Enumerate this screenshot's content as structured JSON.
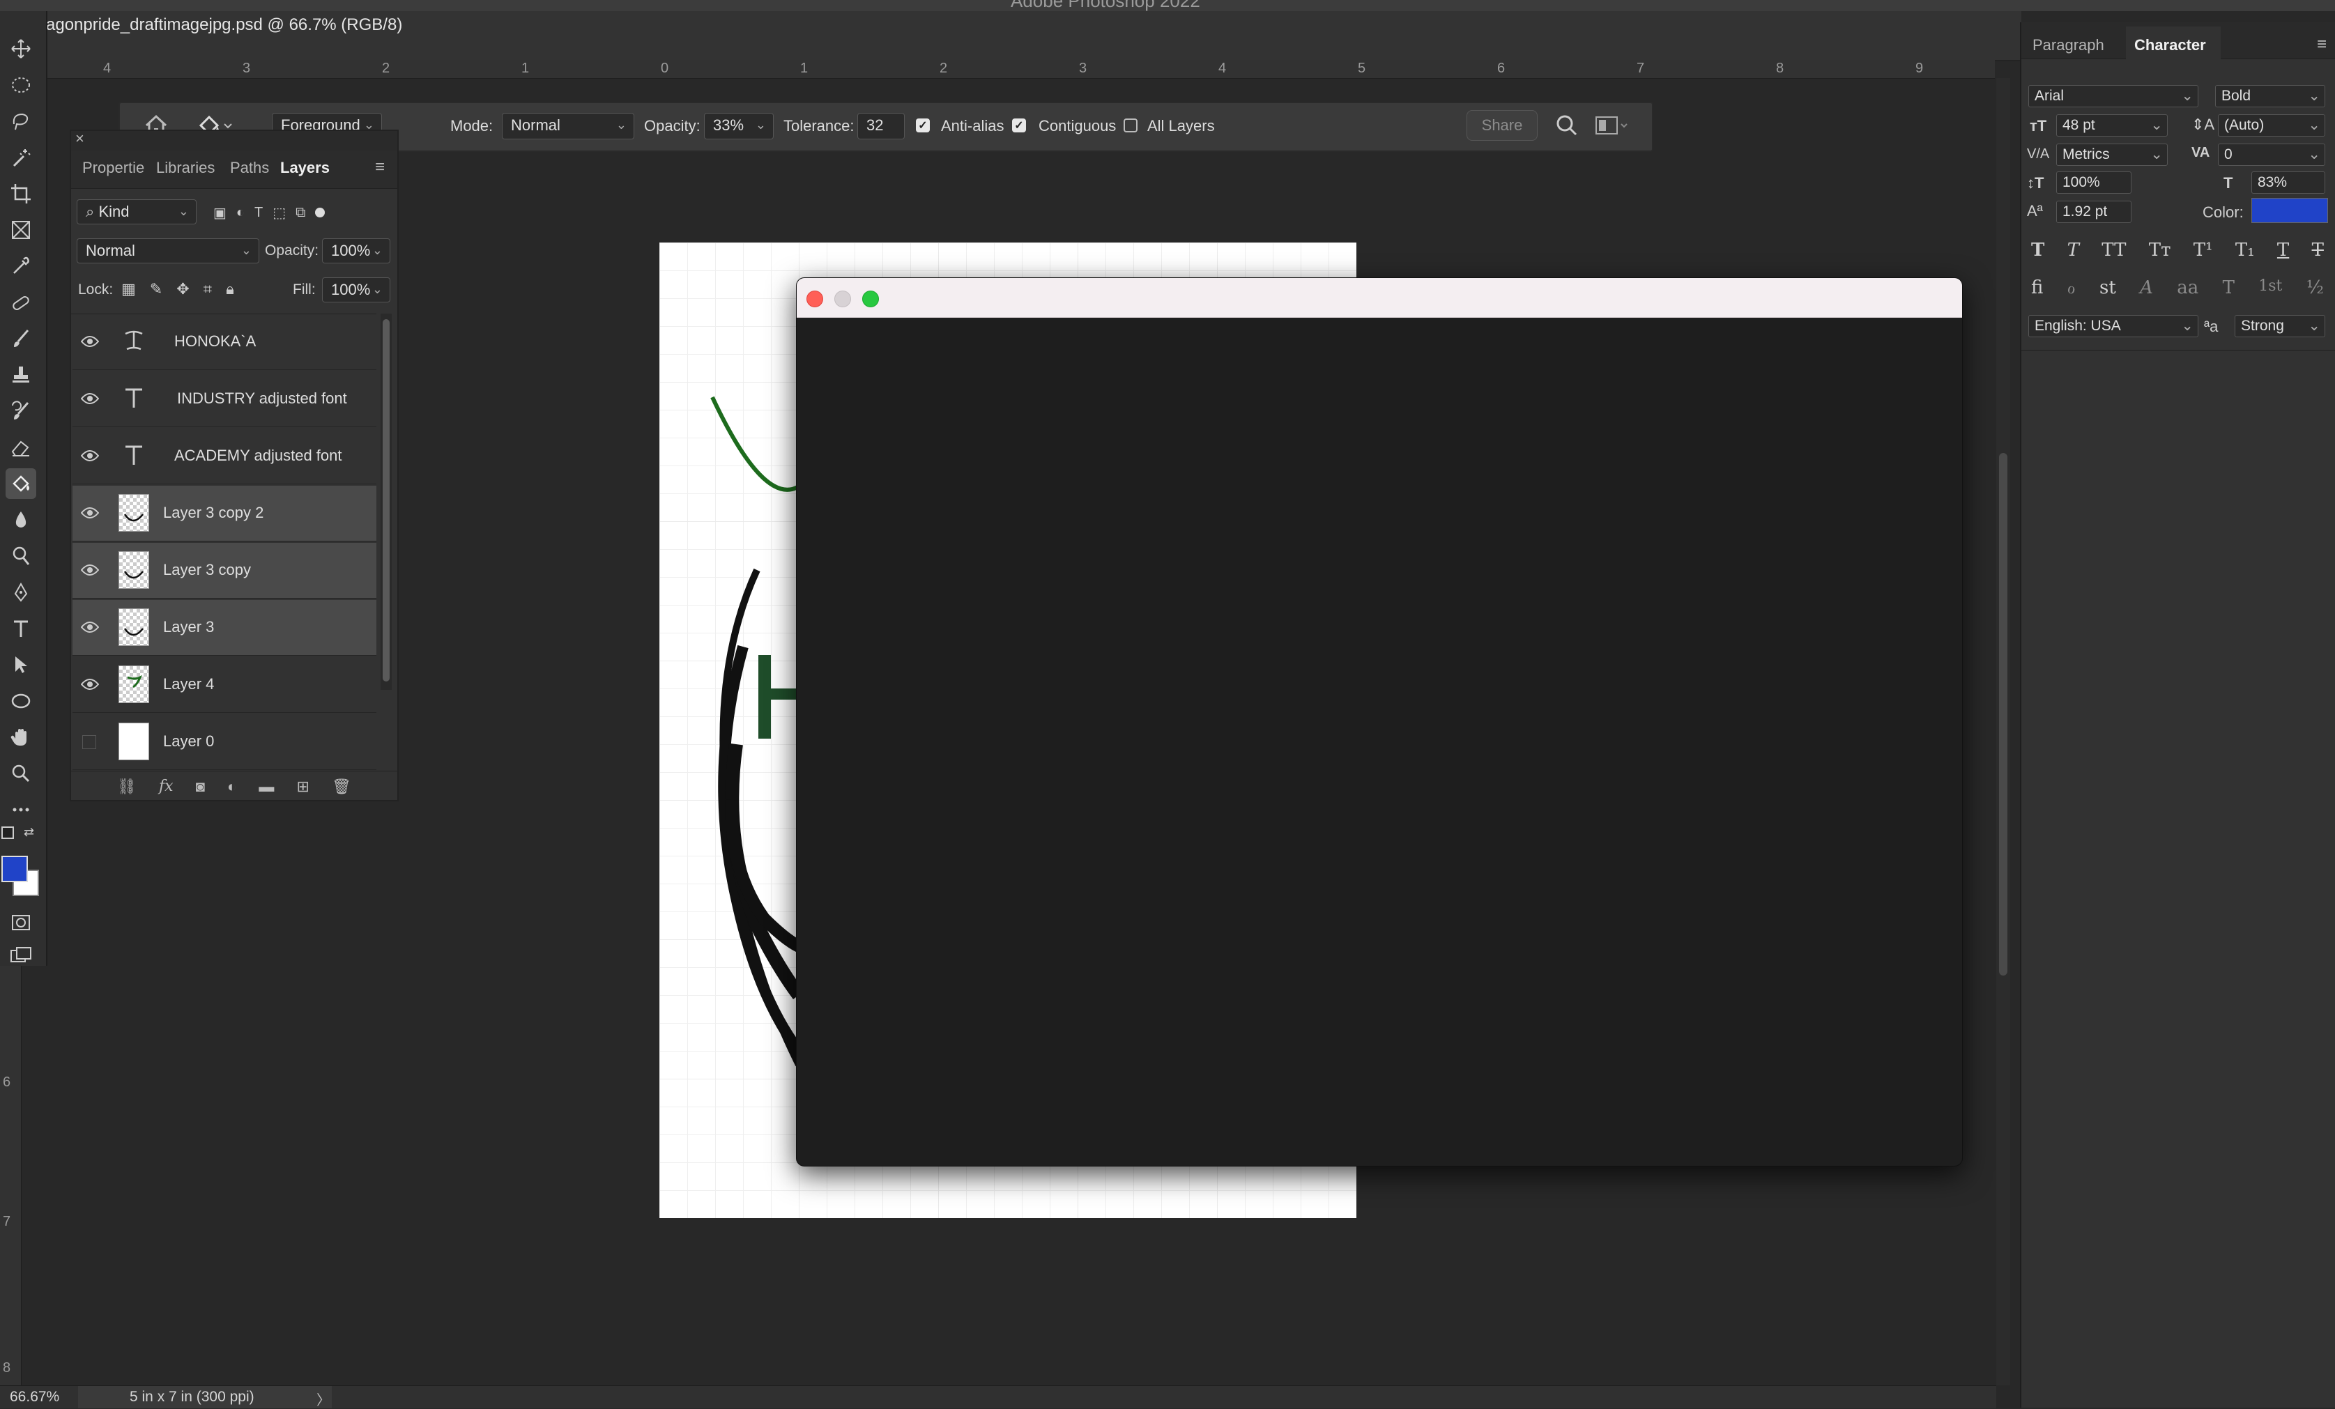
{
  "app": {
    "window_title": "Adobe Photoshop 2022",
    "document_tab": "agonpride_draftimagejpg.psd @ 66.7% (RGB/8)"
  },
  "rulers": {
    "top_marks": [
      "4",
      "3",
      "2",
      "1",
      "0",
      "1",
      "2",
      "3",
      "4",
      "5",
      "6",
      "7",
      "8",
      "9"
    ],
    "left_marks": [
      "6",
      "7",
      "8"
    ]
  },
  "tools": [
    "move-tool",
    "marquee-tool",
    "lasso-tool",
    "magic-wand-tool",
    "crop-tool",
    "frame-tool",
    "eyedropper-tool",
    "healing-brush-tool",
    "brush-tool",
    "clone-stamp-tool",
    "history-brush-tool",
    "eraser-tool",
    "paint-bucket-tool",
    "blur-tool",
    "dodge-tool",
    "pen-tool",
    "type-tool",
    "path-selection-tool",
    "ellipse-tool",
    "hand-tool",
    "zoom-tool",
    "more-tools"
  ],
  "colors": {
    "foreground": "#2043c8",
    "background": "#ffffff",
    "text_color_swatch": "#2043c8"
  },
  "options_bar": {
    "fill_source": "Foreground",
    "mode_label": "Mode:",
    "mode_value": "Normal",
    "opacity_label": "Opacity:",
    "opacity_value": "33%",
    "tolerance_label": "Tolerance:",
    "tolerance_value": "32",
    "anti_alias_label": "Anti-alias",
    "anti_alias_checked": true,
    "contiguous_label": "Contiguous",
    "contiguous_checked": true,
    "all_layers_label": "All Layers",
    "all_layers_checked": false,
    "share_label": "Share"
  },
  "layers_panel": {
    "tabs": [
      "Propertie",
      "Libraries",
      "Paths",
      "Layers"
    ],
    "active_tab": "Layers",
    "filter_kind": "Kind",
    "blend_mode": "Normal",
    "opacity_label": "Opacity:",
    "opacity_value": "100%",
    "lock_label": "Lock:",
    "fill_label": "Fill:",
    "fill_value": "100%",
    "layers": [
      {
        "name": "HONOKA`A",
        "type": "text-warped",
        "visible": true,
        "selected": false
      },
      {
        "name": "INDUSTRY adjusted font",
        "type": "text",
        "visible": true,
        "selected": false
      },
      {
        "name": "ACADEMY adjusted font",
        "type": "text",
        "visible": true,
        "selected": false
      },
      {
        "name": "Layer 3 copy 2",
        "type": "pixel",
        "visible": true,
        "selected": true
      },
      {
        "name": "Layer 3 copy",
        "type": "pixel",
        "visible": true,
        "selected": true
      },
      {
        "name": "Layer 3",
        "type": "pixel",
        "visible": true,
        "selected": true
      },
      {
        "name": "Layer 4",
        "type": "pixel",
        "visible": true,
        "selected": false
      },
      {
        "name": "Layer 0",
        "type": "pixel-white",
        "visible": false,
        "selected": false
      }
    ]
  },
  "character_panel": {
    "tabs": [
      "Paragraph",
      "Character"
    ],
    "active_tab": "Character",
    "font_family": "Arial",
    "font_style": "Bold",
    "font_size": "48 pt",
    "leading": "(Auto)",
    "kerning": "Metrics",
    "tracking": "0",
    "vertical_scale": "100%",
    "horizontal_scale": "83%",
    "baseline_shift": "1.92 pt",
    "color_label": "Color:",
    "language": "English: USA",
    "antialias_symbol": "ªa",
    "antialias": "Strong",
    "style_buttons": [
      "T",
      "T",
      "TT",
      "Tт",
      "T¹",
      "T₁",
      "T",
      "T"
    ],
    "opentype_buttons": [
      "fi",
      "ℴ",
      "st",
      "A",
      "aa",
      "T",
      "1st",
      "½"
    ]
  },
  "status_bar": {
    "zoom": "66.67%",
    "doc_info": "5 in x 7 in (300 ppi)",
    "arrow": "〉"
  }
}
